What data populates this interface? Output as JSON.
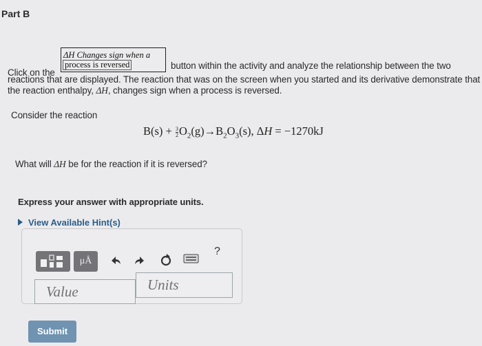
{
  "part": {
    "title": "Part B"
  },
  "instructions": {
    "click_on_the": "Click on the",
    "button_line1": "ΔH Changes sign when a",
    "button_line2": "process is reversed",
    "after_button": "button within the activity and analyze the relationship between the two",
    "line2": "reactions that are displayed. The reaction that was on the screen when you started and its derivative demonstrate that",
    "line3_pre": "the reaction enthalpy, ",
    "line3_dh": "ΔH",
    "line3_post": ", changes sign when a process is reversed."
  },
  "reaction": {
    "intro": "Consider the reaction",
    "lhs1": "B(s) + ",
    "frac_num": "3",
    "frac_den": "2",
    "o2": "O",
    "o2_sub": "2",
    "o2_state": "(g)→B",
    "b_sub": "2",
    "o3": "O",
    "o3_sub": "3",
    "tail": "(s), Δ",
    "h": "H",
    "value": " = −1270kJ"
  },
  "question": {
    "pre": "What will ",
    "dh": "ΔH",
    "post": " be for the reaction if it is reversed?"
  },
  "express": "Express your answer with appropriate units.",
  "hints": {
    "label": "View Available Hint(s)"
  },
  "toolbar": {
    "units_label": "μÅ",
    "undo_icon": "undo-icon",
    "redo_icon": "redo-icon",
    "reset_icon": "reset-icon",
    "keyboard_icon": "keyboard-icon",
    "help_label": "?"
  },
  "answer": {
    "value_placeholder": "Value",
    "units_placeholder": "Units"
  },
  "submit_label": "Submit"
}
